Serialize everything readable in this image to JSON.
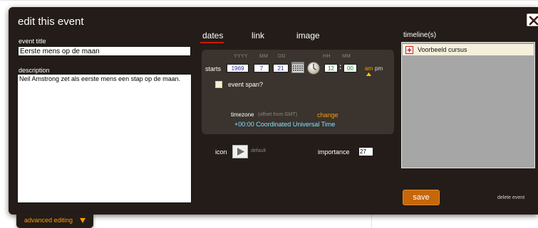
{
  "dialog": {
    "title": "edit this event",
    "close_icon": "close-icon"
  },
  "left": {
    "event_title_label": "event title",
    "event_title_value": "Eerste mens op de maan",
    "description_label": "description",
    "description_value": "Neil Amstrong zet als eerste mens een stap op de maan."
  },
  "tabs": [
    {
      "label": "dates",
      "active": true
    },
    {
      "label": "link",
      "active": false
    },
    {
      "label": "image",
      "active": false
    }
  ],
  "dates": {
    "col_yyyy": "YYYY",
    "col_mm": "MM",
    "col_dd": "DD",
    "col_hh": "HH",
    "col_min": "MM",
    "starts_label": "starts",
    "year": "1969",
    "month": "7",
    "day": "21",
    "hour": "12",
    "minute": "00",
    "colon": ":",
    "am": "am",
    "pm": "pm",
    "selected_meridiem": "am",
    "calendar_icon": "calendar-icon",
    "clock_icon": "clock-icon",
    "event_span_label": "event span?",
    "event_span_checked": false,
    "timezone_label": "timezone",
    "timezone_hint": "(offset from GMT)",
    "timezone_change": "change",
    "timezone_value": "+00:00 Coordinated Universal Time"
  },
  "icon": {
    "label": "icon",
    "value": "default",
    "preview_icon": "play-triangle-icon"
  },
  "importance": {
    "label": "importance",
    "value": "27"
  },
  "timelines": {
    "label": "timeline(s)",
    "items": [
      {
        "name": "Voorbeeld cursus",
        "icon": "plus-box-icon"
      }
    ]
  },
  "actions": {
    "save": "save",
    "delete": "delete event",
    "advanced": "advanced editing",
    "advanced_icon": "triangle-down-icon"
  },
  "colors": {
    "dialog_bg": "#231c18",
    "panel_bg": "#3a332e",
    "accent_orange": "#ff9900",
    "save_button": "#c6670b",
    "tab_underline": "#cc1a00",
    "timezone_text": "#7fe0ff",
    "list_bg": "#a6a6a6",
    "list_item_bg": "#f5f0dc"
  }
}
